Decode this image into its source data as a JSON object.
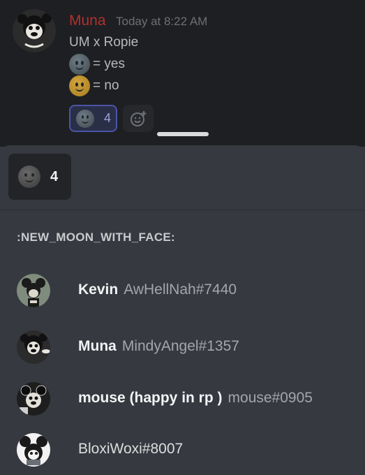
{
  "message": {
    "author": "Muna",
    "timestamp": "Today at 8:22 AM",
    "line1": "UM x Ropie",
    "line2": "= yes",
    "line3": "= no",
    "reaction": {
      "emoji": "new-moon-with-face-icon",
      "count": "4"
    },
    "add_reaction_icon": "add-reaction-icon"
  },
  "sheet": {
    "tab": {
      "emoji": "new-moon-with-face-icon",
      "count": "4"
    },
    "emoji_name": ":NEW_MOON_WITH_FACE:",
    "users": [
      {
        "nickname": "Kevin",
        "tag": "AwHellNah#7440"
      },
      {
        "nickname": "Muna",
        "tag": "MindyAngel#1357"
      },
      {
        "nickname": "mouse (happy in rp )",
        "tag": "mouse#0905"
      },
      {
        "nickname": "",
        "tag": "BloxiWoxi#8007"
      }
    ]
  },
  "colors": {
    "author": "#b0312f",
    "reaction_border": "#4a54a8",
    "sheet_bg": "#36393f"
  }
}
